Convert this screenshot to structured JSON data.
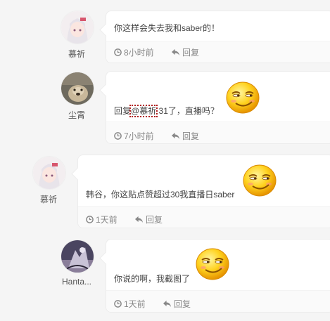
{
  "comments": [
    {
      "user": "慕祈",
      "text": "你这样会失去我和saber的！",
      "time": "8小时前",
      "reply_label": "回复"
    },
    {
      "user": "尘霄",
      "text_prefix": "回复",
      "mention": "@慕祈",
      "text_suffix": " 31了，直播吗？",
      "time": "7小时前",
      "reply_label": "回复"
    },
    {
      "user": "慕祈",
      "text": "韩谷，你这贴点赞超过30我直播日saber",
      "time": "1天前",
      "reply_label": "回复"
    },
    {
      "user": "Hanta...",
      "text": "你说的啊，我截图了",
      "time": "1天前",
      "reply_label": "回复"
    }
  ],
  "icons": {
    "time": "clock-icon",
    "reply": "reply-arrow-icon",
    "emoji": "smirk-emoji-icon"
  },
  "colors": {
    "background": "#f5f5f5",
    "mention_outline": "#b02020",
    "emoji_face": "#f5b800"
  }
}
